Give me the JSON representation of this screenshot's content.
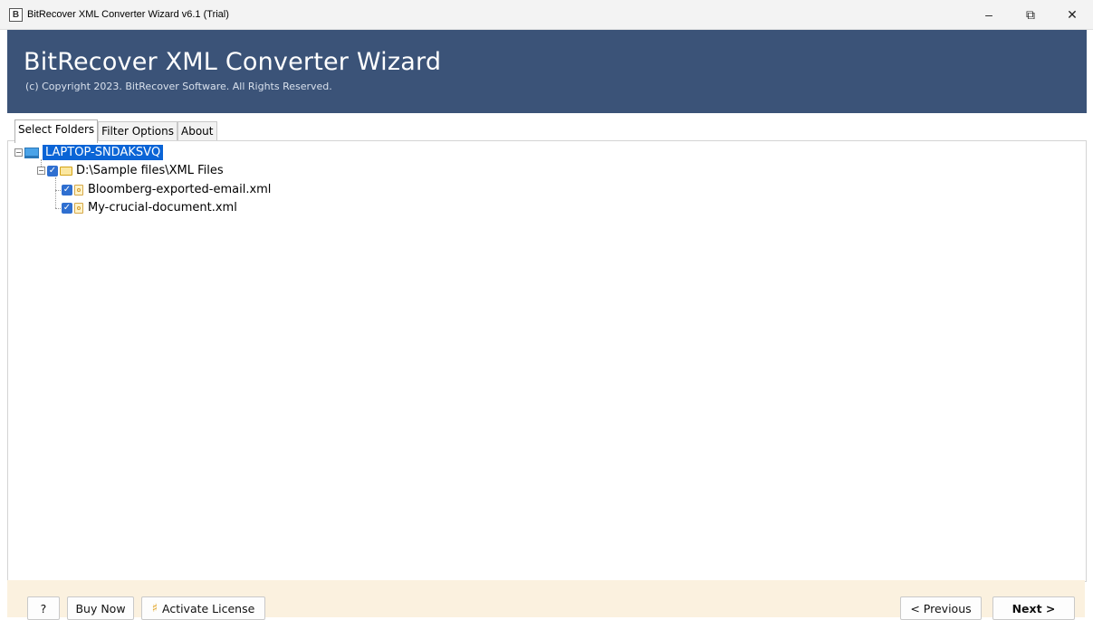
{
  "window": {
    "app_icon": "B",
    "title": "BitRecover XML Converter Wizard v6.1 (Trial)",
    "minimize_glyph": "–",
    "restore_glyph": "⧉",
    "close_glyph": "✕"
  },
  "banner": {
    "title": "BitRecover XML Converter Wizard",
    "copyright": "(c) Copyright 2023. BitRecover Software. All Rights Reserved.",
    "background_color": "#3b5378"
  },
  "tabs": [
    {
      "label": "Select Folders",
      "active": true
    },
    {
      "label": "Filter Options",
      "active": false
    },
    {
      "label": "About",
      "active": false
    }
  ],
  "tree": {
    "root": {
      "label": "LAPTOP-SNDAKSVQ",
      "icon": "computer-icon",
      "selected": true,
      "expander": "−"
    },
    "folder": {
      "label": "D:\\Sample files\\XML Files",
      "icon": "folder-icon",
      "checked": true,
      "expander": "−"
    },
    "files": [
      {
        "label": "Bloomberg-exported-email.xml",
        "icon": "xml-file-icon",
        "checked": true
      },
      {
        "label": "My-crucial-document.xml",
        "icon": "xml-file-icon",
        "checked": true
      }
    ],
    "check_glyph": "✓"
  },
  "footer": {
    "help_label": "?",
    "buy_now_label": "Buy Now",
    "activate_label": "Activate License",
    "previous_label": "< Previous",
    "next_label": "Next >",
    "background_color": "#fbf1df"
  }
}
